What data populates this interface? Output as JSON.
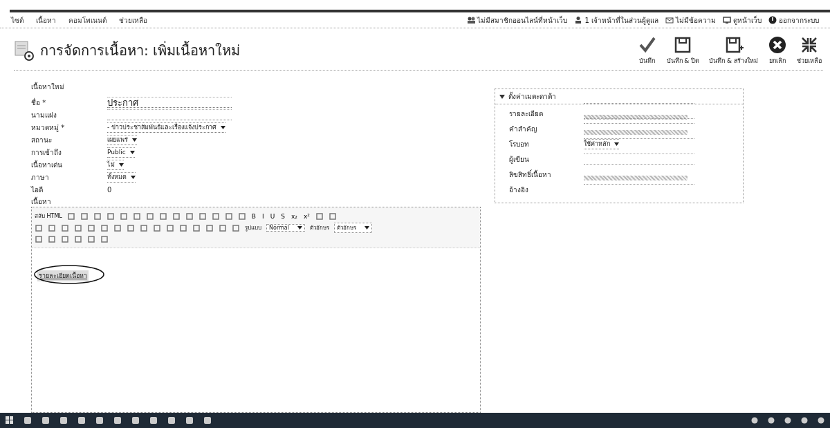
{
  "menu": [
    {
      "label": "ไซต์"
    },
    {
      "label": "เนื้อหา"
    },
    {
      "label": "คอมโพเนนต์"
    },
    {
      "label": "ช่วยเหลือ"
    }
  ],
  "status_links": [
    {
      "label": "ไม่มีสมาชิกออนไลน์ที่หน้าเว็บ",
      "kind": "users"
    },
    {
      "label": "1 เจ้าหน้าที่ในส่วนผู้ดูแล",
      "kind": "admin"
    },
    {
      "label": "ไม่มีข้อความ",
      "kind": "mail"
    },
    {
      "label": "ดูหน้าเว็บ",
      "kind": "view"
    },
    {
      "label": "ออกจากระบบ",
      "kind": "logout"
    }
  ],
  "page_title": "การจัดการเนื้อหา: เพิ่มเนื้อหาใหม่",
  "toolbar": [
    {
      "label": "บันทึก",
      "kind": "check"
    },
    {
      "label": "บันทึก & ปิด",
      "kind": "save"
    },
    {
      "label": "บันทึก & สร้างใหม่",
      "kind": "savenew"
    },
    {
      "label": "ยกเลิก",
      "kind": "cancel"
    },
    {
      "label": "ช่วยเหลือ",
      "kind": "help"
    }
  ],
  "form": {
    "title": "เนื้อหาใหม่",
    "fields": [
      {
        "label": "ชื่อ *",
        "kind": "text",
        "value": "ประกาศ"
      },
      {
        "label": "นามแฝง",
        "kind": "text"
      },
      {
        "label": "หมวดหมู่ *",
        "kind": "select",
        "value": "- ข่าวประชาสัมพันธ์และเรื่องแจ้งประกาศ"
      },
      {
        "label": "สถานะ",
        "kind": "select",
        "value": "เผยแพร่"
      },
      {
        "label": "การเข้าถึง",
        "kind": "select",
        "value": "Public"
      },
      {
        "label": "เนื้อหาเด่น",
        "kind": "select",
        "value": "ไม่"
      },
      {
        "label": "ภาษา",
        "kind": "select",
        "value": "ทั้งหมด"
      },
      {
        "label": "ไอดี",
        "kind": "static",
        "value": "0"
      }
    ],
    "content_label": "เนื้อหา"
  },
  "editor": {
    "toggle": "สลับ HTML",
    "letters": [
      "B",
      "I",
      "U",
      "S",
      "x₂",
      "x²"
    ],
    "format_label": "รูปแบบ",
    "format_value": "Normal",
    "font_label": "ตัวอักษร",
    "font_value": "ตัวอักษร",
    "content": "รายละเอียดเนื้อหา"
  },
  "metadata": {
    "title": "ตั้งค่าเมตะดาต้า",
    "expanded": true,
    "fields": [
      {
        "label": "รายละเอียด",
        "kind": "textarea"
      },
      {
        "label": "คำสำคัญ",
        "kind": "textarea"
      },
      {
        "label": "โรบอท",
        "kind": "select",
        "value": "ใช้ค่าหลัก"
      },
      {
        "label": "ผู้เขียน",
        "kind": "text"
      },
      {
        "label": "ลิขสิทธิ์เนื้อหา",
        "kind": "textarea"
      },
      {
        "label": "อ้างอิง",
        "kind": "static"
      }
    ]
  }
}
